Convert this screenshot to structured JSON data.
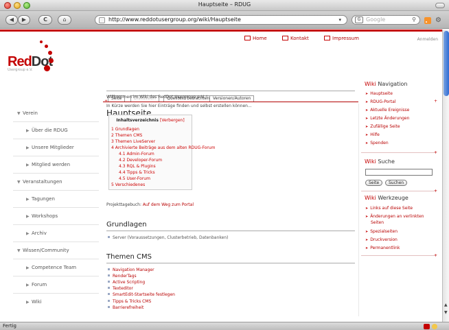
{
  "window": {
    "title": "Hauptseite – RDUG"
  },
  "toolbar": {
    "back": "◀",
    "forward": "▶",
    "reload": "C",
    "home": "⌂",
    "url": "http://www.reddotusergroup.org/wiki/Hauptseite",
    "url_dropdown": "▾",
    "search_placeholder": "Google",
    "search_engine": "G"
  },
  "header": {
    "nav": [
      {
        "label": "Home",
        "icon": "home-icon"
      },
      {
        "label": "Kontakt",
        "icon": "contact-icon"
      },
      {
        "label": "Impressum",
        "icon": "imprint-icon"
      }
    ],
    "login": "Anmelden",
    "logo_text_red": "Red",
    "logo_text_dark": "Dot",
    "logo_sub": "Usergroup e.V."
  },
  "tabs": [
    {
      "label": "Seite",
      "enabled": true
    },
    {
      "label": "Diskussion",
      "enabled": false
    },
    {
      "label": "Quelltext betrachten",
      "enabled": true
    },
    {
      "label": "Versionen/Autoren",
      "enabled": true
    }
  ],
  "sidebar": {
    "items": [
      {
        "label": "Verein",
        "level": 0
      },
      {
        "label": "Über die RDUG",
        "level": 1
      },
      {
        "label": "Unsere Mitglieder",
        "level": 1
      },
      {
        "label": "Mitglied werden",
        "level": 1
      },
      {
        "label": "Veranstaltungen",
        "level": 0
      },
      {
        "label": "Tagungen",
        "level": 1
      },
      {
        "label": "Workshops",
        "level": 1
      },
      {
        "label": "Archiv",
        "level": 1
      },
      {
        "label": "Wissen/Community",
        "level": 0
      },
      {
        "label": "Competence Team",
        "level": 1
      },
      {
        "label": "Forum",
        "level": 1
      },
      {
        "label": "Wiki",
        "level": 1
      }
    ]
  },
  "content": {
    "title": "Hauptseite",
    "intro1": "Willkommen im Wiki des RedDot Usergroup e.V. !",
    "intro2": "In Kürze werden Sie hier Einträge finden und selbst erstellen können...",
    "toc_title": "Inhaltsverzeichnis",
    "toc_toggle": "[Verbergen]",
    "toc": [
      "1 Grundlagen",
      "2 Themen CMS",
      "3 Themen LiveServer",
      "4 Archivierte Beiträge aus dem alten RDUG-Forum",
      "4.1 Admin-Forum",
      "4.2 Developer-Forum",
      "4.3 RQL & Plugins",
      "4.4 Tipps & Tricks",
      "4.5 User-Forum",
      "5 Verschiedenes"
    ],
    "projekt_label": "Projekttagebuch:",
    "projekt_link": "Auf dem Weg zum Portal",
    "h_grundlagen": "Grundlagen",
    "grundlagen_items": [
      "Server (Voraussetzungen, Clusterbetrieb, Datenbanken)"
    ],
    "h_cms": "Themen CMS",
    "cms_items": [
      "Navigation Manager",
      "RenderTags",
      "Active Scripting",
      "Texteditor",
      "SmartEdit-Startseite festlegen",
      "Tipps & Tricks CMS",
      "Barrierefreiheit"
    ]
  },
  "right": {
    "nav_head_red": "Wiki",
    "nav_head_rest": " Navigation",
    "nav_items": [
      "Hauptseite",
      "RDUG-Portal",
      "Aktuelle Ereignisse",
      "Letzte Änderungen",
      "Zufällige Seite",
      "Hilfe",
      "Spenden"
    ],
    "search_head_red": "Wiki",
    "search_head_rest": " Suche",
    "btn_seite": "Seite",
    "btn_suchen": "Suchen",
    "tools_head_red": "Wiki",
    "tools_head_rest": " Werkzeuge",
    "tool_items": [
      "Links auf diese Seite",
      "Änderungen an verlinkten",
      "Seiten",
      "Spezialseiten",
      "Druckversion",
      "Permanentlink"
    ]
  },
  "status": {
    "text": "Fertig"
  },
  "colors": {
    "brand_red": "#c40000",
    "link_red": "#b80000"
  }
}
